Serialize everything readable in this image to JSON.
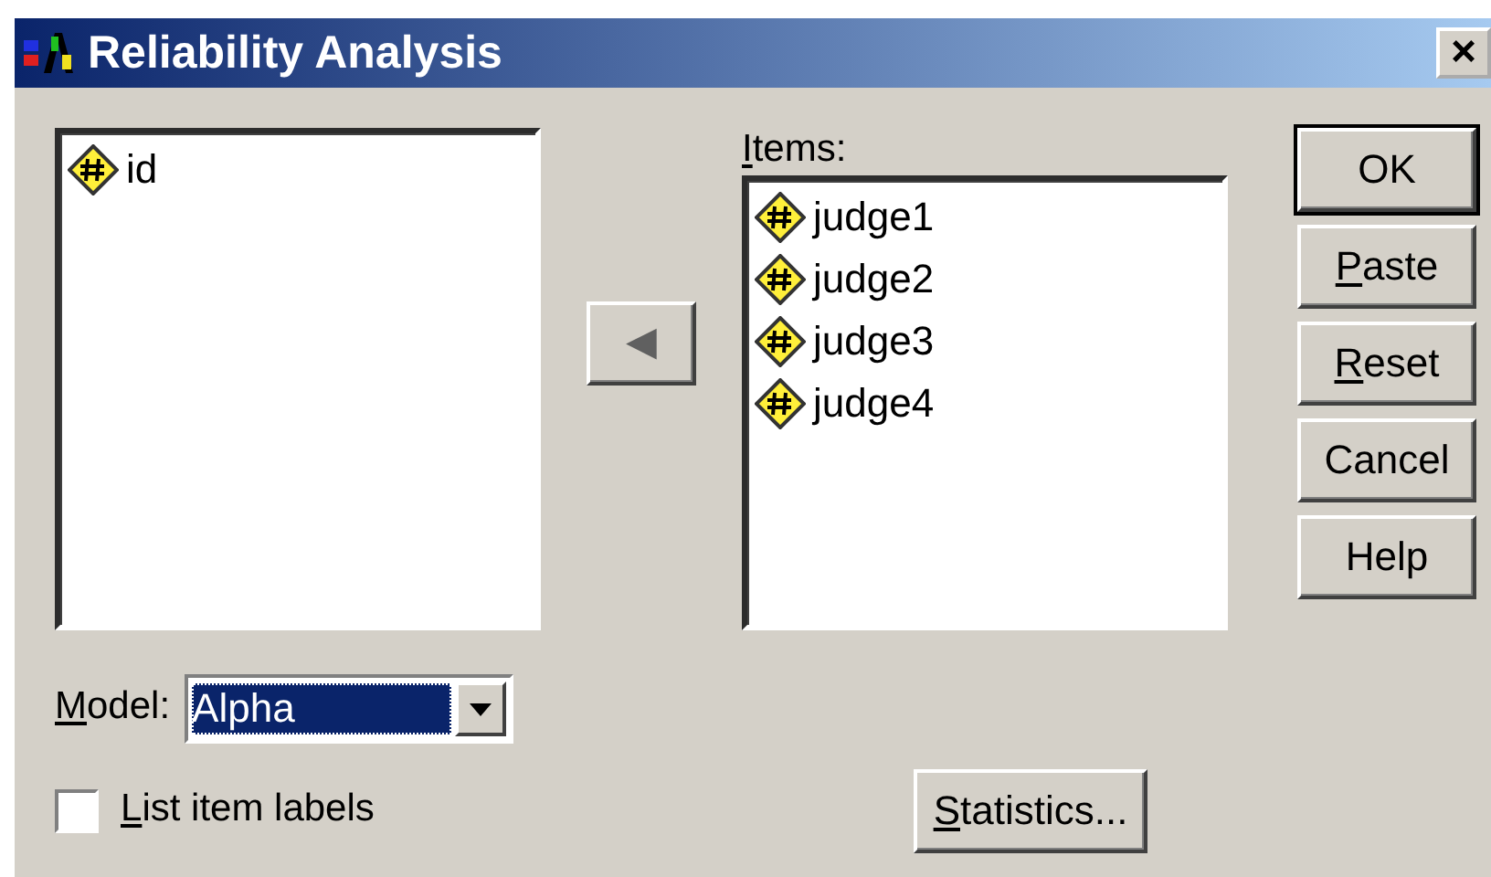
{
  "window": {
    "title": "Reliability Analysis",
    "close": "×"
  },
  "variables": [
    {
      "name": "id",
      "selected": false
    }
  ],
  "move_button": {
    "glyph": "◀"
  },
  "items": {
    "label": "Items:",
    "mnemonic": true,
    "list": [
      {
        "name": "judge1",
        "selected": false
      },
      {
        "name": "judge2",
        "selected": false
      },
      {
        "name": "judge3",
        "selected": false
      },
      {
        "name": "judge4",
        "selected": false
      }
    ]
  },
  "buttons": [
    {
      "label": "OK",
      "mnemonic": false,
      "default": true
    },
    {
      "label": "Paste",
      "mnemonic": true,
      "default": false
    },
    {
      "label": "Reset",
      "mnemonic": true,
      "default": false
    },
    {
      "label": "Cancel",
      "mnemonic": false,
      "default": false
    },
    {
      "label": "Help",
      "mnemonic": false,
      "default": false
    }
  ],
  "model": {
    "label": "Model:",
    "mnemonic": true,
    "value": "Alpha"
  },
  "list_item_labels": {
    "label": "List item labels",
    "mnemonic": true,
    "checked": false
  },
  "statistics_button": {
    "label": "Statistics...",
    "mnemonic": true
  }
}
